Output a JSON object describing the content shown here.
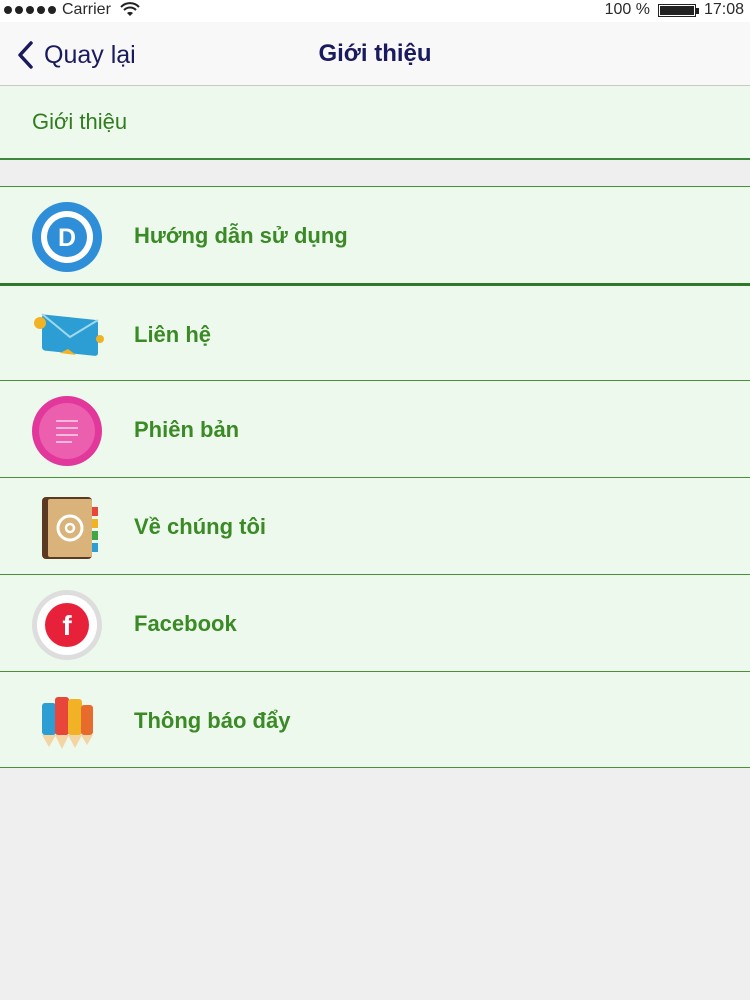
{
  "status_bar": {
    "carrier": "Carrier",
    "battery_percent": "100 %",
    "battery_level": 1.0,
    "time": "17:08"
  },
  "nav": {
    "back_label": "Quay lại",
    "title": "Giới thiệu"
  },
  "section": {
    "title": "Giới thiệu"
  },
  "menu": [
    {
      "label": "Hướng dẫn sử dụng",
      "icon": "guide-d-icon"
    },
    {
      "label": "Liên hệ",
      "icon": "mail-envelope-icon"
    },
    {
      "label": "Phiên bản",
      "icon": "version-list-icon"
    },
    {
      "label": "Về chúng tôi",
      "icon": "address-book-icon"
    },
    {
      "label": "Facebook",
      "icon": "facebook-icon"
    },
    {
      "label": "Thông báo đẩy",
      "icon": "pencils-icon"
    }
  ],
  "colors": {
    "accent_green": "#3a8a25",
    "row_bg": "#eef9ee",
    "nav_text": "#1a1a5e"
  }
}
